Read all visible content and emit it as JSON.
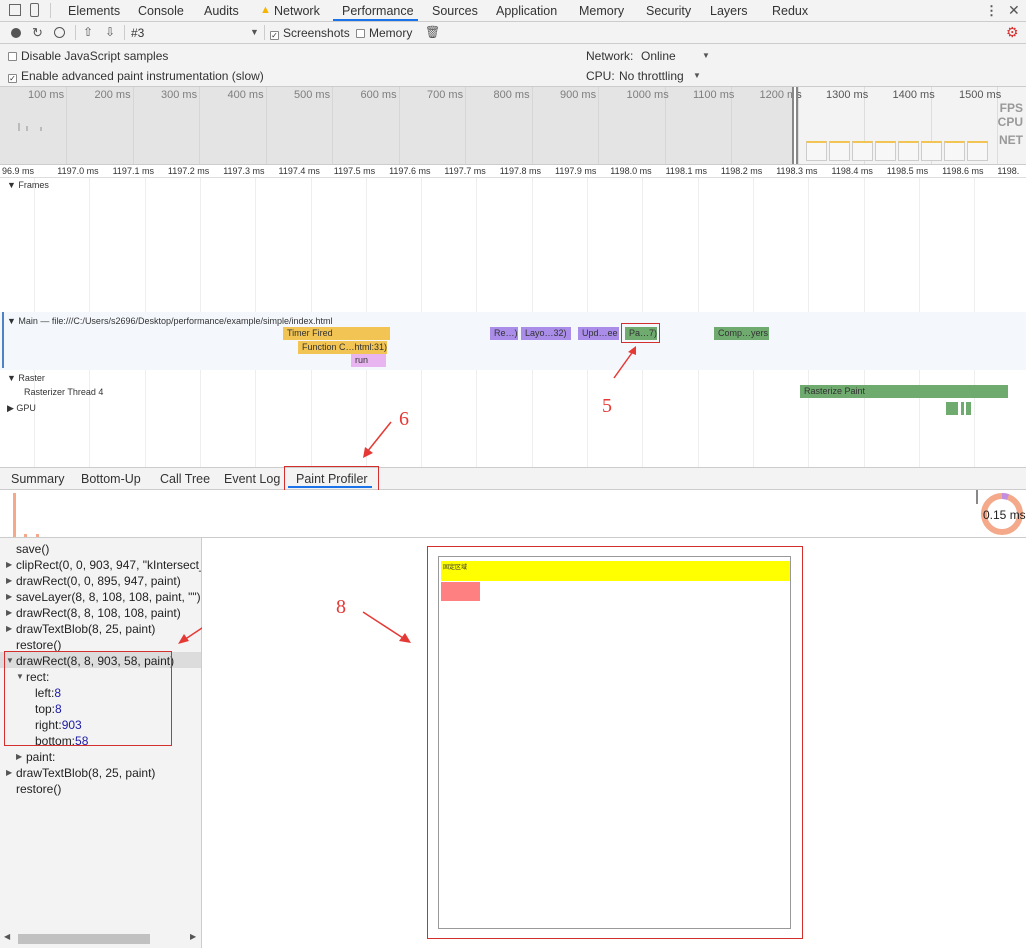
{
  "tabs": [
    "Elements",
    "Console",
    "Audits",
    "Network",
    "Performance",
    "Sources",
    "Application",
    "Memory",
    "Security",
    "Layers",
    "Redux"
  ],
  "toolbar": {
    "profile": "#3",
    "screenshots": "Screenshots",
    "memory": "Memory"
  },
  "settings": {
    "disable_js": "Disable JavaScript samples",
    "adv_paint": "Enable advanced paint instrumentation (slow)",
    "network_label": "Network:",
    "network_value": "Online",
    "cpu_label": "CPU:",
    "cpu_value": "No throttling"
  },
  "overview": {
    "ticks": [
      "100 ms",
      "200 ms",
      "300 ms",
      "400 ms",
      "500 ms",
      "600 ms",
      "700 ms",
      "800 ms",
      "900 ms",
      "1000 ms",
      "1100 ms",
      "1200 ms",
      "1300 ms",
      "1400 ms",
      "1500 ms",
      "16"
    ],
    "fps": "FPS",
    "cpu": "CPU",
    "net": "NET"
  },
  "ruler": [
    "96.9 ms",
    "1197.0 ms",
    "1197.1 ms",
    "1197.2 ms",
    "1197.3 ms",
    "1197.4 ms",
    "1197.5 ms",
    "1197.6 ms",
    "1197.7 ms",
    "1197.8 ms",
    "1197.9 ms",
    "1198.0 ms",
    "1198.1 ms",
    "1198.2 ms",
    "1198.3 ms",
    "1198.4 ms",
    "1198.5 ms",
    "1198.6 ms",
    "1198."
  ],
  "tracks": {
    "frames": "Frames",
    "main": "Main — file:///C:/Users/s2696/Desktop/performance/example/simple/index.html",
    "raster": "Raster",
    "raster_thread": "Rasterizer Thread 4",
    "gpu": "GPU"
  },
  "events": {
    "timer": "Timer Fired",
    "function": "Function C…html:31)",
    "run": "run",
    "recalc": "Re…)",
    "layout": "Layo…32)",
    "update": "Upd…ee",
    "paint": "Pa…7)",
    "composite": "Comp…yers",
    "raster_paint": "Rasterize Paint"
  },
  "annotations": [
    "5",
    "6",
    "7",
    "8"
  ],
  "bottom_tabs": [
    "Summary",
    "Bottom-Up",
    "Call Tree",
    "Event Log",
    "Paint Profiler"
  ],
  "strip": {
    "time": "0.15 ms"
  },
  "log": {
    "items": [
      "save()",
      "clipRect(0, 0, 903, 947, \"kIntersect_0",
      "drawRect(0, 0, 895, 947, paint)",
      "saveLayer(8, 8, 108, 108, paint, \"\")",
      "drawRect(8, 8, 108, 108, paint)",
      "drawTextBlob(8, 25, paint)",
      "restore()",
      "drawRect(8, 8, 903, 58, paint)"
    ],
    "rect": "rect:",
    "props": [
      {
        "k": "left:",
        "v": "8"
      },
      {
        "k": "top:",
        "v": "8"
      },
      {
        "k": "right:",
        "v": "903"
      },
      {
        "k": "bottom:",
        "v": "58"
      }
    ],
    "paint": "paint:",
    "after": [
      "drawTextBlob(8, 25, paint)",
      "restore()"
    ]
  },
  "preview": {
    "banner_text": "固定区域"
  }
}
